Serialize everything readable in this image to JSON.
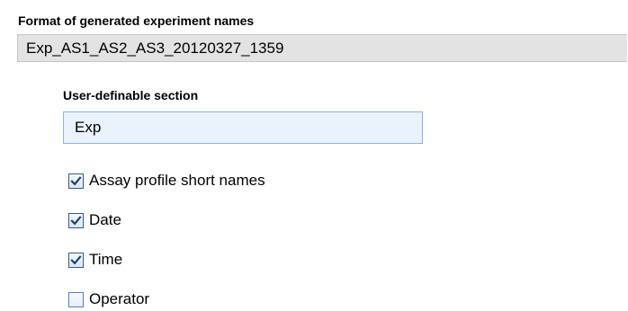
{
  "format_section": {
    "title": "Format of generated experiment names",
    "generated_name": "Exp_AS1_AS2_AS3_20120327_1359"
  },
  "user_section": {
    "label": "User-definable section",
    "value": "Exp"
  },
  "options": [
    {
      "label": "Assay profile short names",
      "checked": true
    },
    {
      "label": "Date",
      "checked": true
    },
    {
      "label": "Time",
      "checked": true
    },
    {
      "label": "Operator",
      "checked": false
    }
  ],
  "colors": {
    "readonly_field_bg": "#e3e3e3",
    "input_bg": "#eaf2fd",
    "input_border": "#8bb2e2",
    "checkbox_border": "#2f5b97",
    "checkmark": "#1c3f73"
  }
}
